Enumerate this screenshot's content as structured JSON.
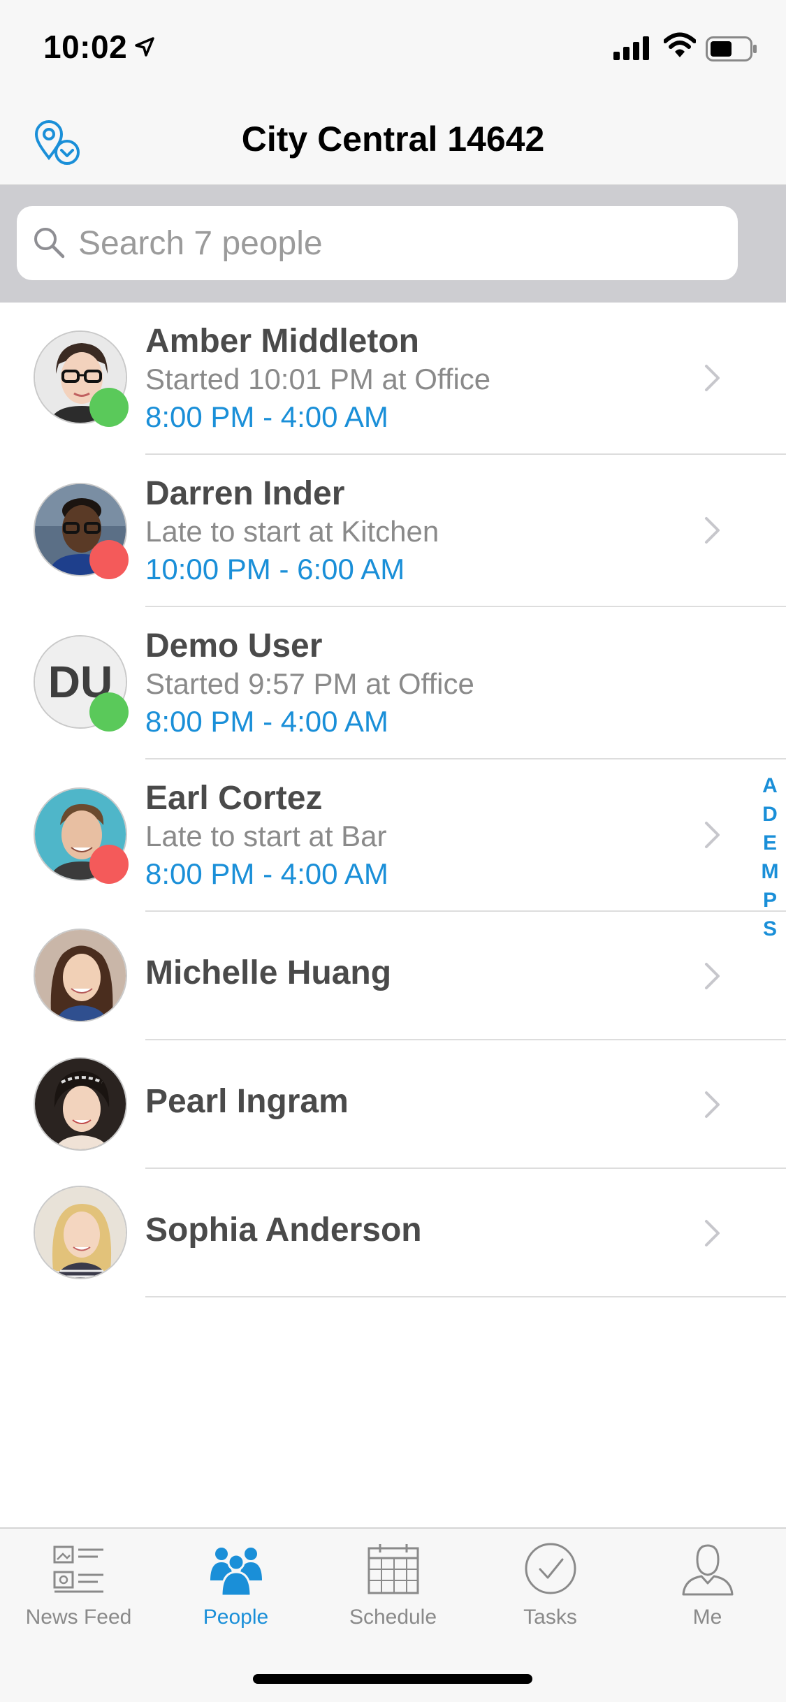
{
  "status_bar": {
    "time": "10:02"
  },
  "nav": {
    "title": "City Central 14642"
  },
  "search": {
    "placeholder": "Search 7 people"
  },
  "people": [
    {
      "name": "Amber Middleton",
      "status_text": "Started 10:01 PM at Office",
      "shift": "8:00 PM - 4:00 AM",
      "presence": "green"
    },
    {
      "name": "Darren Inder",
      "status_text": "Late to start at Kitchen",
      "shift": "10:00 PM - 6:00 AM",
      "presence": "red"
    },
    {
      "name": "Demo User",
      "initials": "DU",
      "status_text": "Started 9:57 PM at Office",
      "shift": "8:00 PM - 4:00 AM",
      "presence": "green"
    },
    {
      "name": "Earl Cortez",
      "status_text": "Late to start at Bar",
      "shift": "8:00 PM - 4:00 AM",
      "presence": "red"
    },
    {
      "name": "Michelle Huang"
    },
    {
      "name": "Pearl Ingram"
    },
    {
      "name": "Sophia Anderson"
    }
  ],
  "index_letters": [
    "A",
    "D",
    "E",
    "M",
    "P",
    "S"
  ],
  "tabs": [
    {
      "label": "News Feed",
      "icon": "news-feed-icon"
    },
    {
      "label": "People",
      "icon": "people-icon",
      "active": true
    },
    {
      "label": "Schedule",
      "icon": "calendar-icon"
    },
    {
      "label": "Tasks",
      "icon": "check-circle-icon"
    },
    {
      "label": "Me",
      "icon": "person-icon"
    }
  ],
  "colors": {
    "accent": "#1a8fd8",
    "online": "#5ac95a",
    "late": "#f45a5a"
  }
}
